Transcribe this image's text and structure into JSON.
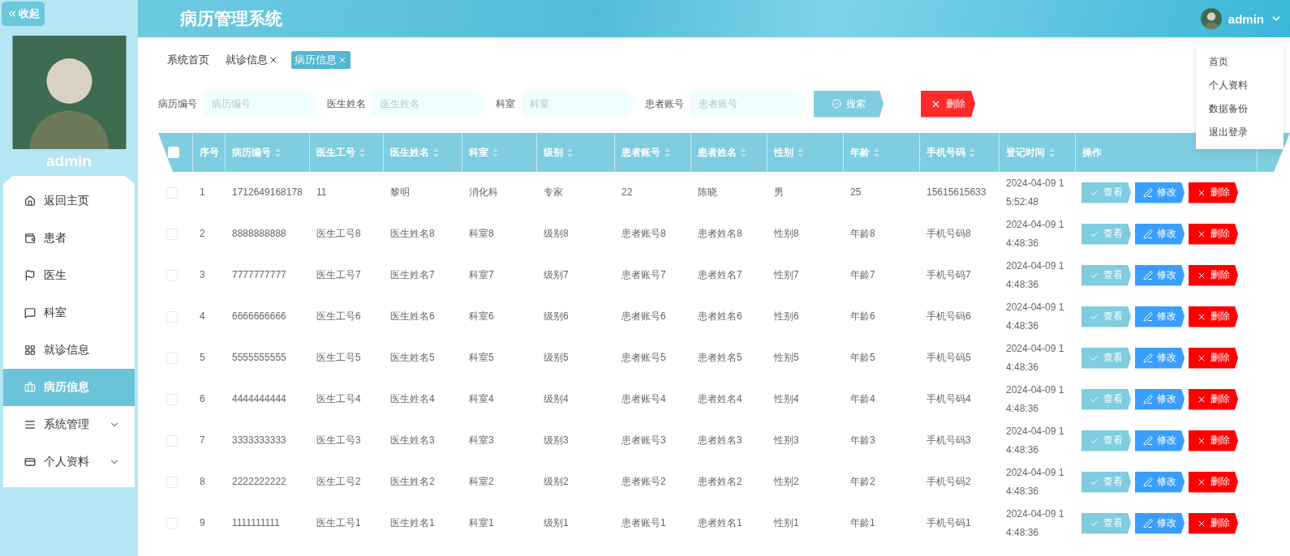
{
  "header": {
    "title": "病历管理系统",
    "user_name": "admin",
    "user_menu": [
      "首页",
      "个人资料",
      "数据备份",
      "退出登录"
    ]
  },
  "sidebar": {
    "collapse_label": "收起",
    "user_name": "admin",
    "items": [
      {
        "label": "返回主页",
        "selected": false,
        "expandable": false
      },
      {
        "label": "患者",
        "selected": false,
        "expandable": false
      },
      {
        "label": "医生",
        "selected": false,
        "expandable": false
      },
      {
        "label": "科室",
        "selected": false,
        "expandable": false
      },
      {
        "label": "就诊信息",
        "selected": false,
        "expandable": false
      },
      {
        "label": "病历信息",
        "selected": true,
        "expandable": false
      },
      {
        "label": "系统管理",
        "selected": false,
        "expandable": true
      },
      {
        "label": "个人资料",
        "selected": false,
        "expandable": true
      }
    ]
  },
  "tabs": [
    {
      "label": "系统首页",
      "selected": false,
      "closable": false
    },
    {
      "label": "就诊信息",
      "selected": false,
      "closable": true
    },
    {
      "label": "病历信息",
      "selected": true,
      "closable": true
    }
  ],
  "search": {
    "fields": [
      {
        "label": "病历编号",
        "placeholder": "病历编号"
      },
      {
        "label": "医生姓名",
        "placeholder": "医生姓名"
      },
      {
        "label": "科室",
        "placeholder": "科室"
      },
      {
        "label": "患者账号",
        "placeholder": "患者账号"
      }
    ],
    "search_button": "搜索",
    "delete_button": "删除"
  },
  "table": {
    "select_all": false,
    "columns": [
      {
        "label": "序号",
        "sortable": false
      },
      {
        "label": "病历编号",
        "sortable": true
      },
      {
        "label": "医生工号",
        "sortable": true
      },
      {
        "label": "医生姓名",
        "sortable": true
      },
      {
        "label": "科室",
        "sortable": true
      },
      {
        "label": "级别",
        "sortable": true
      },
      {
        "label": "患者账号",
        "sortable": true
      },
      {
        "label": "患者姓名",
        "sortable": true
      },
      {
        "label": "性别",
        "sortable": true
      },
      {
        "label": "年龄",
        "sortable": true
      },
      {
        "label": "手机号码",
        "sortable": true
      },
      {
        "label": "登记时间",
        "sortable": true
      },
      {
        "label": "操作",
        "sortable": false
      }
    ],
    "rows": [
      {
        "checked": false,
        "cells": [
          "1",
          "1712649168178",
          "11",
          "黎明",
          "消化科",
          "专家",
          "22",
          "陈晓",
          "男",
          "25",
          "15615615633",
          "2024-04-09 15:52:48"
        ],
        "actions": [
          {
            "kind": "view",
            "label": "查看"
          },
          {
            "kind": "edit",
            "label": "修改"
          },
          {
            "kind": "delete",
            "label": "删除"
          }
        ]
      },
      {
        "checked": false,
        "cells": [
          "2",
          "8888888888",
          "医生工号8",
          "医生姓名8",
          "科室8",
          "级别8",
          "患者账号8",
          "患者姓名8",
          "性别8",
          "年龄8",
          "手机号码8",
          "2024-04-09 14:48:36"
        ],
        "actions": [
          {
            "kind": "view",
            "label": "查看"
          },
          {
            "kind": "edit",
            "label": "修改"
          },
          {
            "kind": "delete",
            "label": "删除"
          }
        ]
      },
      {
        "checked": false,
        "cells": [
          "3",
          "7777777777",
          "医生工号7",
          "医生姓名7",
          "科室7",
          "级别7",
          "患者账号7",
          "患者姓名7",
          "性别7",
          "年龄7",
          "手机号码7",
          "2024-04-09 14:48:36"
        ],
        "actions": [
          {
            "kind": "view",
            "label": "查看"
          },
          {
            "kind": "edit",
            "label": "修改"
          },
          {
            "kind": "delete",
            "label": "删除"
          }
        ]
      },
      {
        "checked": false,
        "cells": [
          "4",
          "6666666666",
          "医生工号6",
          "医生姓名6",
          "科室6",
          "级别6",
          "患者账号6",
          "患者姓名6",
          "性别6",
          "年龄6",
          "手机号码6",
          "2024-04-09 14:48:36"
        ],
        "actions": [
          {
            "kind": "view",
            "label": "查看"
          },
          {
            "kind": "edit",
            "label": "修改"
          },
          {
            "kind": "delete",
            "label": "删除"
          }
        ]
      },
      {
        "checked": false,
        "cells": [
          "5",
          "5555555555",
          "医生工号5",
          "医生姓名5",
          "科室5",
          "级别5",
          "患者账号5",
          "患者姓名5",
          "性别5",
          "年龄5",
          "手机号码5",
          "2024-04-09 14:48:36"
        ],
        "actions": [
          {
            "kind": "view",
            "label": "查看"
          },
          {
            "kind": "edit",
            "label": "修改"
          },
          {
            "kind": "delete",
            "label": "删除"
          }
        ]
      },
      {
        "checked": false,
        "cells": [
          "6",
          "4444444444",
          "医生工号4",
          "医生姓名4",
          "科室4",
          "级别4",
          "患者账号4",
          "患者姓名4",
          "性别4",
          "年龄4",
          "手机号码4",
          "2024-04-09 14:48:36"
        ],
        "actions": [
          {
            "kind": "view",
            "label": "查看"
          },
          {
            "kind": "edit",
            "label": "修改"
          },
          {
            "kind": "delete",
            "label": "删除"
          }
        ]
      },
      {
        "checked": false,
        "cells": [
          "7",
          "3333333333",
          "医生工号3",
          "医生姓名3",
          "科室3",
          "级别3",
          "患者账号3",
          "患者姓名3",
          "性别3",
          "年龄3",
          "手机号码3",
          "2024-04-09 14:48:36"
        ],
        "actions": [
          {
            "kind": "view",
            "label": "查看"
          },
          {
            "kind": "edit",
            "label": "修改"
          },
          {
            "kind": "delete",
            "label": "删除"
          }
        ]
      },
      {
        "checked": false,
        "cells": [
          "8",
          "2222222222",
          "医生工号2",
          "医生姓名2",
          "科室2",
          "级别2",
          "患者账号2",
          "患者姓名2",
          "性别2",
          "年龄2",
          "手机号码2",
          "2024-04-09 14:48:36"
        ],
        "actions": [
          {
            "kind": "view",
            "label": "查看"
          },
          {
            "kind": "edit",
            "label": "修改"
          },
          {
            "kind": "delete",
            "label": "删除"
          }
        ]
      },
      {
        "checked": false,
        "cells": [
          "9",
          "1111111111",
          "医生工号1",
          "医生姓名1",
          "科室1",
          "级别1",
          "患者账号1",
          "患者姓名1",
          "性别1",
          "年龄1",
          "手机号码1",
          "2024-04-09 14:48:36"
        ],
        "actions": [
          {
            "kind": "view",
            "label": "查看"
          },
          {
            "kind": "edit",
            "label": "修改"
          },
          {
            "kind": "delete",
            "label": "删除"
          }
        ]
      }
    ]
  }
}
